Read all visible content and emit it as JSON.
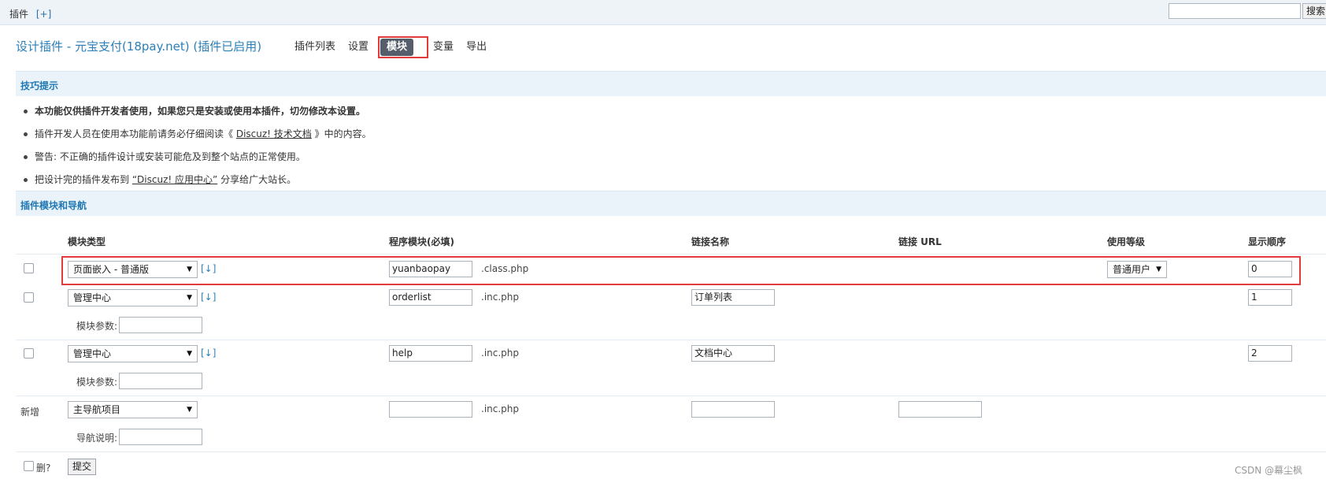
{
  "topbar": {
    "label": "插件",
    "plus": "[+]",
    "search_button": "搜索"
  },
  "title": "设计插件 - 元宝支付(18pay.net) (插件已启用)",
  "nav": {
    "list": "插件列表",
    "settings": "设置",
    "modules": "模块",
    "vars": "变量",
    "export": "导出"
  },
  "tips": {
    "header": "技巧提示",
    "t1": "本功能仅供插件开发者使用，如果您只是安装或使用本插件，切勿修改本设置。",
    "t2_pre": "插件开发人员在使用本功能前请务必仔细阅读《",
    "t2_link": "Discuz! 技术文档",
    "t2_post": "》中的内容。",
    "t3": "警告: 不正确的插件设计或安装可能危及到整个站点的正常使用。",
    "t4_pre": "把设计完的插件发布到",
    "t4_link": "“Discuz! 应用中心”",
    "t4_post": "分享给广大站长。"
  },
  "modules": {
    "header": "插件模块和导航",
    "cols": {
      "type": "模块类型",
      "program": "程序模块(必填)",
      "link_name": "链接名称",
      "link_url": "链接 URL",
      "level": "使用等级",
      "order": "显示顺序"
    },
    "reorder": "[↓]",
    "rows": [
      {
        "type": "页面嵌入 - 普通版",
        "program": "yuanbaopay",
        "suffix": ".class.php",
        "link_name": "",
        "level": "普通用户",
        "order": "0"
      },
      {
        "type": "管理中心",
        "program": "orderlist",
        "suffix": ".inc.php",
        "link_name": "订单列表",
        "order": "1",
        "param_label": "模块参数:"
      },
      {
        "type": "管理中心",
        "program": "help",
        "suffix": ".inc.php",
        "link_name": "文档中心",
        "order": "2",
        "param_label": "模块参数:"
      }
    ],
    "new_row": {
      "label": "新增",
      "type": "主导航项目",
      "suffix": ".inc.php",
      "nav_desc_label": "导航说明:"
    },
    "delete_label": "删?",
    "submit": "提交"
  },
  "watermark": "CSDN @幕尘枫"
}
